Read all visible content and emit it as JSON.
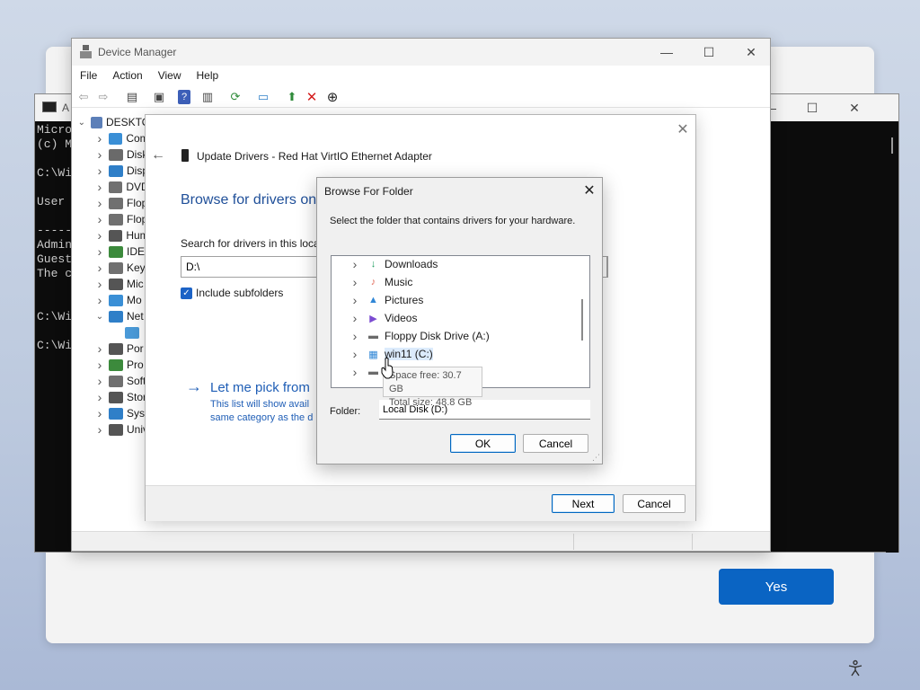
{
  "oobe": {
    "yes_label": "Yes"
  },
  "cmd": {
    "title": "A",
    "lines": [
      "Micro",
      "(c) M",
      "",
      "C:\\Wi",
      "",
      "User",
      "",
      "-----",
      "Admin",
      "Guest",
      "The c",
      "",
      "",
      "C:\\Wi",
      "",
      "C:\\Wi"
    ]
  },
  "device_manager": {
    "title": "Device Manager",
    "menu": [
      "File",
      "Action",
      "View",
      "Help"
    ],
    "tree_root": "DESKTO",
    "tree_items": [
      {
        "label": "Com",
        "expanded": false,
        "icon_color": "#3a8fd6"
      },
      {
        "label": "Disk",
        "expanded": false,
        "icon_color": "#6a6a6a"
      },
      {
        "label": "Disp",
        "expanded": false,
        "icon_color": "#2f7fc8"
      },
      {
        "label": "DVD",
        "expanded": false,
        "icon_color": "#707070"
      },
      {
        "label": "Flop",
        "expanded": false,
        "icon_color": "#707070"
      },
      {
        "label": "Flop",
        "expanded": false,
        "icon_color": "#707070"
      },
      {
        "label": "Hum",
        "expanded": false,
        "icon_color": "#555555"
      },
      {
        "label": "IDE",
        "expanded": false,
        "icon_color": "#3c8a3c"
      },
      {
        "label": "Key",
        "expanded": false,
        "icon_color": "#707070"
      },
      {
        "label": "Mic",
        "expanded": false,
        "icon_color": "#555555"
      },
      {
        "label": "Mo",
        "expanded": false,
        "icon_color": "#3a8fd6"
      },
      {
        "label": "Net",
        "expanded": true,
        "icon_color": "#2f7fc8"
      },
      {
        "label": "",
        "expanded": null,
        "icon_color": "#4a9ad8"
      },
      {
        "label": "Por",
        "expanded": false,
        "icon_color": "#555555"
      },
      {
        "label": "Pro",
        "expanded": false,
        "icon_color": "#3c8a3c"
      },
      {
        "label": "Soft",
        "expanded": false,
        "icon_color": "#707070"
      },
      {
        "label": "Stor",
        "expanded": false,
        "icon_color": "#555555"
      },
      {
        "label": "Syst",
        "expanded": false,
        "icon_color": "#2f7fc8"
      },
      {
        "label": "Univ",
        "expanded": false,
        "icon_color": "#555555"
      }
    ]
  },
  "wizard": {
    "title": "Update Drivers - Red Hat VirtIO Ethernet Adapter",
    "heading": "Browse for drivers on",
    "search_label": "Search for drivers in this locat",
    "path_value": "D:\\",
    "include_subfolders": "Include subfolders",
    "pick_link": "Let me pick from",
    "pick_desc1": "This list will show avail",
    "pick_desc2": "same category as the d",
    "next_label": "Next",
    "cancel_label": "Cancel"
  },
  "browse_folder": {
    "title": "Browse For Folder",
    "instruction": "Select the folder that contains drivers for your hardware.",
    "items": [
      {
        "label": "Downloads",
        "icon": "download-icon",
        "color": "#1a9b5c",
        "glyph": "↓"
      },
      {
        "label": "Music",
        "icon": "music-icon",
        "color": "#e06a5a",
        "glyph": "♪"
      },
      {
        "label": "Pictures",
        "icon": "pictures-icon",
        "color": "#2f86d6",
        "glyph": "▲"
      },
      {
        "label": "Videos",
        "icon": "videos-icon",
        "color": "#7b4bd1",
        "glyph": "▶"
      },
      {
        "label": "Floppy Disk Drive (A:)",
        "icon": "floppy-drive-icon",
        "color": "#6a6a6a",
        "glyph": "▬"
      },
      {
        "label": "win11 (C:)",
        "icon": "windows-drive-icon",
        "color": "#2f86d6",
        "glyph": "▦"
      },
      {
        "label": "",
        "icon": "drive-icon",
        "color": "#6a6a6a",
        "glyph": "▬"
      }
    ],
    "tooltip_line1": "Space free: 30.7 GB",
    "tooltip_line2": "Total size: 48.8 GB",
    "folder_label": "Folder:",
    "folder_value": "Local Disk (D:)",
    "ok_label": "OK",
    "cancel_label": "Cancel"
  }
}
